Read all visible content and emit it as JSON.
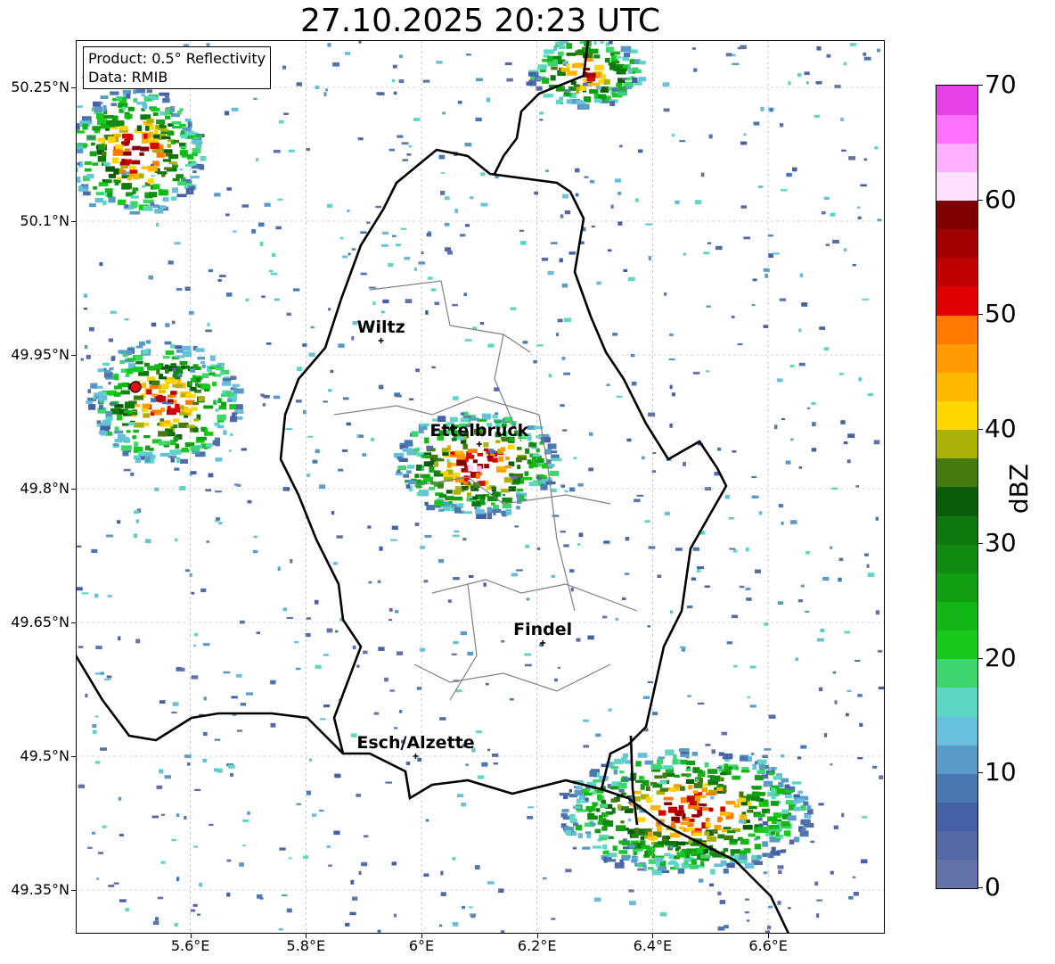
{
  "title": "27.10.2025 20:23 UTC",
  "info": {
    "product": "Product: 0.5° Reflectivity",
    "data": "Data: RMIB"
  },
  "lat_labels": [
    "50.25°N",
    "50.1°N",
    "49.95°N",
    "49.8°N",
    "49.65°N",
    "49.5°N",
    "49.35°N"
  ],
  "lon_labels": [
    "5.6°E",
    "5.8°E",
    "6°E",
    "6.2°E",
    "6.4°E",
    "6.6°E"
  ],
  "cities": [
    {
      "name": "Wiltz",
      "lon": 5.93,
      "lat": 49.966
    },
    {
      "name": "Ettelbruck",
      "lon": 6.1,
      "lat": 49.85
    },
    {
      "name": "Findel",
      "lon": 6.21,
      "lat": 49.627
    },
    {
      "name": "Esch/Alzette",
      "lon": 5.99,
      "lat": 49.5
    }
  ],
  "radar_site": {
    "lon": 5.505,
    "lat": 49.914,
    "color": "#e01010"
  },
  "map_extent": {
    "lon_min": 5.4,
    "lon_max": 6.8,
    "lat_min": 49.3,
    "lat_max": 50.3
  },
  "colorbar": {
    "unit": "dBZ",
    "min": 0,
    "max": 70,
    "tick_labels": [
      "0",
      "10",
      "20",
      "30",
      "40",
      "50",
      "60",
      "70"
    ],
    "colors": [
      "#6373a8",
      "#556aa5",
      "#4560a6",
      "#4a77b0",
      "#5a9ac6",
      "#66c0dc",
      "#5ed6c4",
      "#3ed46e",
      "#16c91a",
      "#12b716",
      "#129e12",
      "#128a12",
      "#0e780e",
      "#0a5c0a",
      "#457a10",
      "#aab20a",
      "#ffd700",
      "#ffb800",
      "#ff9a00",
      "#ff7800",
      "#e00000",
      "#c00000",
      "#a00000",
      "#800000",
      "#ffe0ff",
      "#ffb0ff",
      "#ff70ff",
      "#e840e8"
    ]
  },
  "reflectivity_areas": [
    {
      "name": "west-cluster",
      "lon": 5.55,
      "lat": 49.9,
      "rlon": 0.13,
      "rlat": 0.07,
      "level": 22
    },
    {
      "name": "northwest-band",
      "lon": 5.5,
      "lat": 50.18,
      "rlon": 0.12,
      "rlat": 0.07,
      "level": 24
    },
    {
      "name": "ettelbruck-cluster",
      "lon": 6.09,
      "lat": 49.83,
      "rlon": 0.14,
      "rlat": 0.06,
      "level": 25
    },
    {
      "name": "southeast-band",
      "lon": 6.45,
      "lat": 49.44,
      "rlon": 0.22,
      "rlat": 0.07,
      "level": 24
    },
    {
      "name": "northeast-band",
      "lon": 6.28,
      "lat": 50.27,
      "rlon": 0.1,
      "rlat": 0.04,
      "level": 22
    }
  ]
}
